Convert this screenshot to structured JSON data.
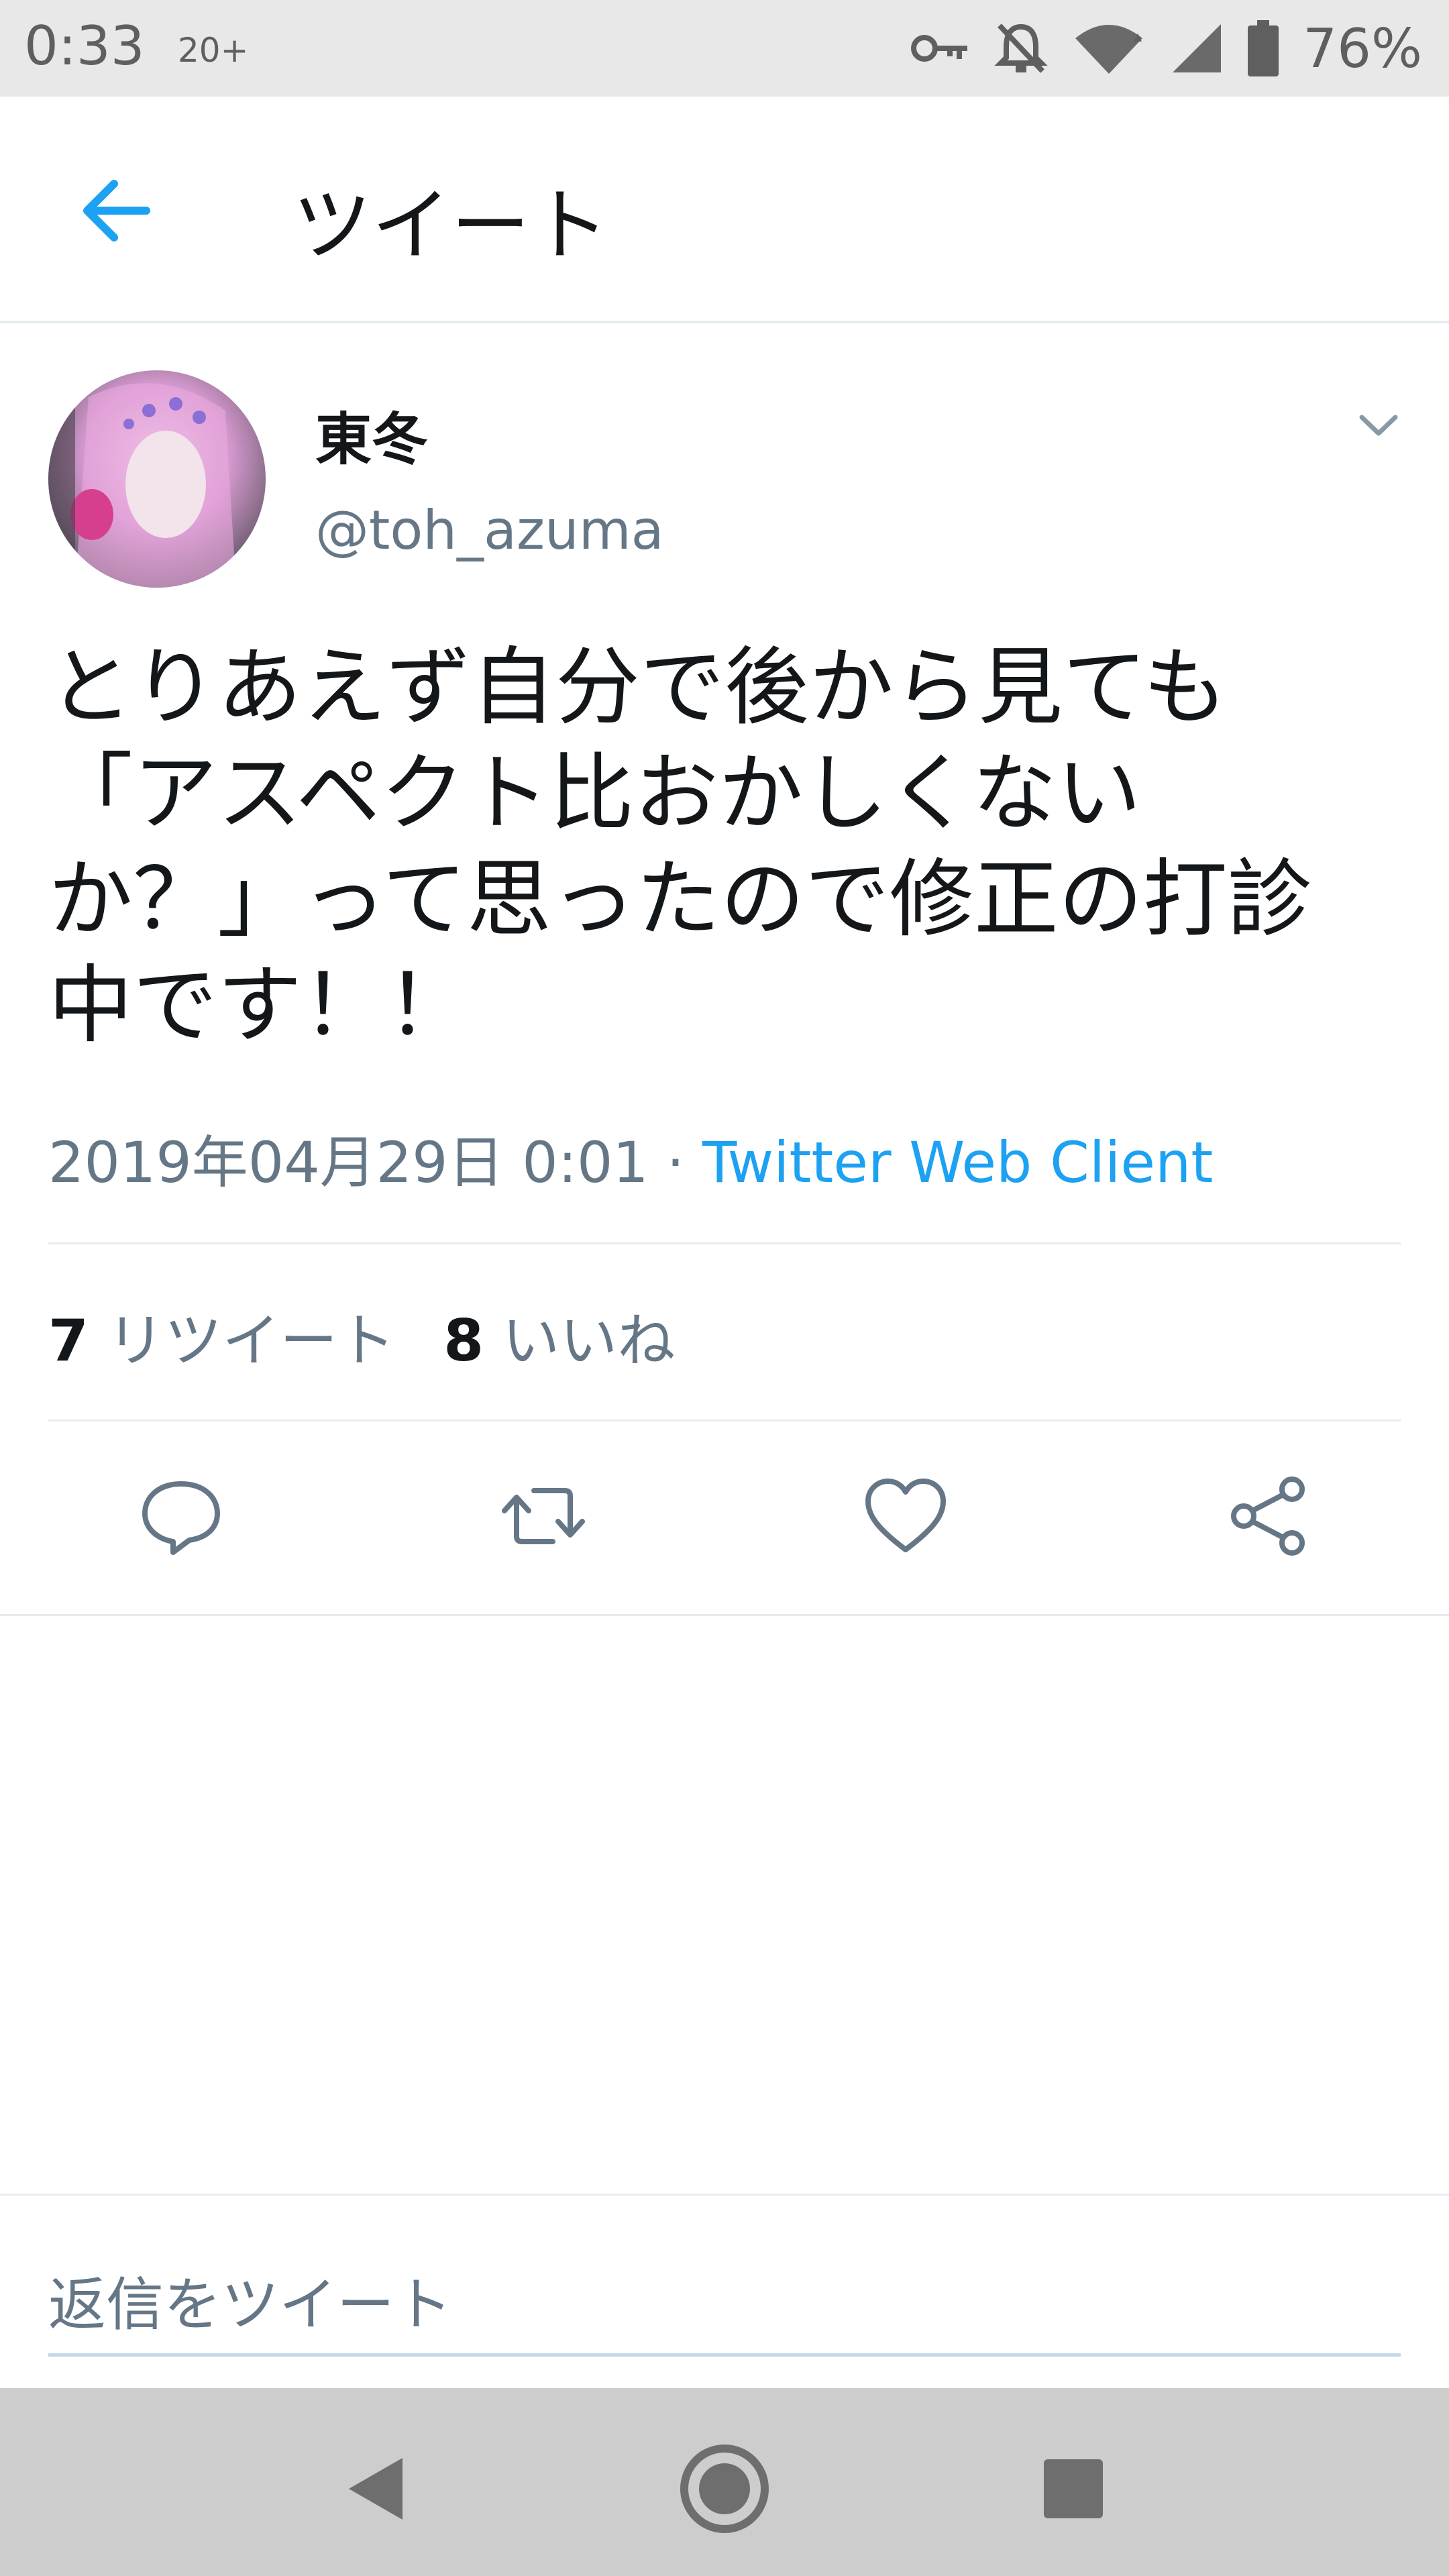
{
  "status_bar": {
    "time": "0:33",
    "badge": "20+",
    "battery": "76%",
    "icons": [
      "key-icon",
      "notifications-off-icon",
      "wifi-icon",
      "signal-icon",
      "battery-icon"
    ]
  },
  "header": {
    "back_icon": "arrow-left-icon",
    "title": "ツイート"
  },
  "tweet": {
    "author": {
      "display_name": "東冬",
      "handle": "@toh_azuma"
    },
    "text": "とりあえず自分で後から見ても\n「アスペクト比おかしくない\nか？」って思ったので修正の打診\n中です！！",
    "timestamp": "2019年04月29日 0:01",
    "separator": " · ",
    "source": "Twitter Web Client",
    "stats": {
      "retweets": "7",
      "retweets_label": "リツイート",
      "likes": "8",
      "likes_label": "いいね"
    }
  },
  "actions": [
    "reply-icon",
    "retweet-icon",
    "like-icon",
    "share-icon"
  ],
  "reply": {
    "placeholder": "返信をツイート"
  },
  "colors": {
    "accent": "#1da1f2",
    "secondary_text": "#657786",
    "primary_text": "#14171a",
    "status_bar_bg": "#e8e8e8",
    "nav_bar_bg": "#cdcdcd"
  }
}
